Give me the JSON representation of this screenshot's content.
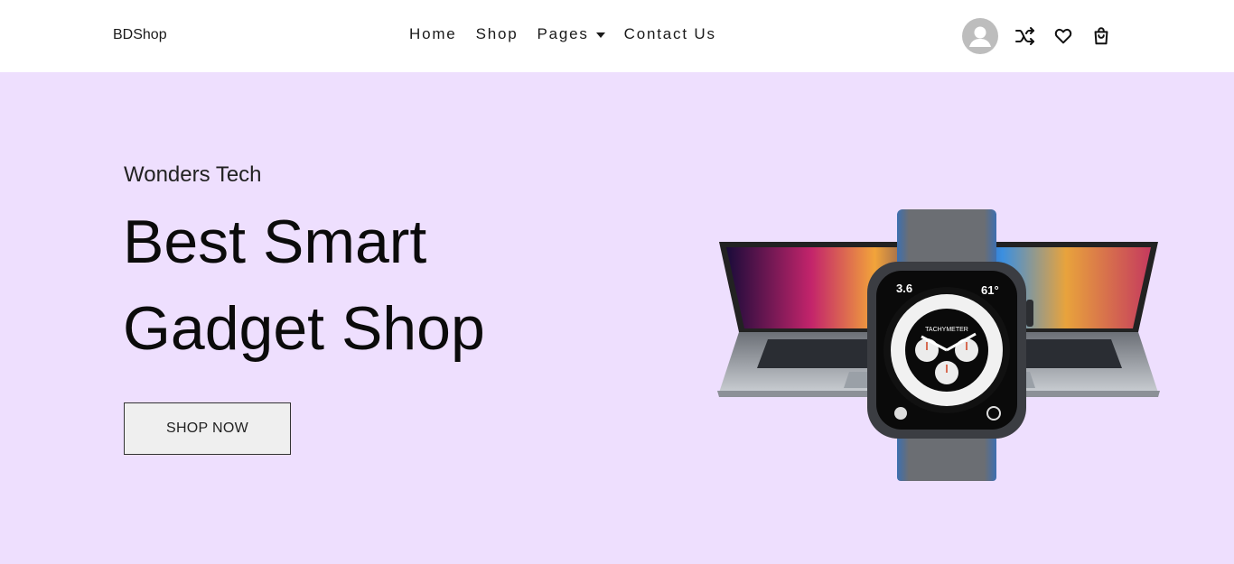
{
  "navbar": {
    "brand": "BDShop",
    "links": [
      {
        "label": "Home"
      },
      {
        "label": "Shop"
      },
      {
        "label": "Pages"
      },
      {
        "label": "Contact Us"
      }
    ],
    "icons": [
      "user-avatar-icon",
      "shuffle-icon",
      "heart-icon",
      "shopping-bag-icon"
    ]
  },
  "hero": {
    "subtitle": "Wonders Tech",
    "title_line1": "Best Smart",
    "title_line2": "Gadget Shop",
    "cta_label": "SHOP NOW",
    "background_color": "#eedffe",
    "image": {
      "description_icon": "laptop-and-smartwatch-image",
      "watch_face_text": "TACHYMETER"
    }
  }
}
